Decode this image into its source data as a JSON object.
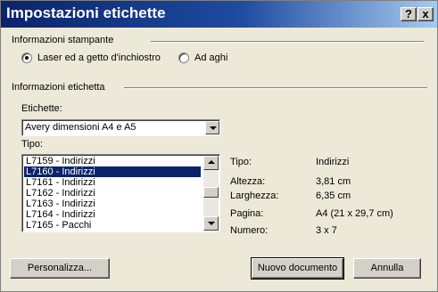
{
  "window": {
    "title": "Impostazioni etichette",
    "help_label": "?",
    "close_label": "x"
  },
  "printer": {
    "label": "Informazioni stampante",
    "options": [
      {
        "label": "Laser ed a getto d'inchiostro",
        "checked": true
      },
      {
        "label": "Ad aghi",
        "checked": false
      }
    ]
  },
  "label_info": {
    "label": "Informazioni etichetta",
    "vendor_label": "Etichette:",
    "vendor_value": "Avery dimensioni A4 e A5",
    "type_label": "Tipo:",
    "types": [
      "L7159 - Indirizzi",
      "L7160 - Indirizzi",
      "L7161 - Indirizzi",
      "L7162 - Indirizzi",
      "L7163 - Indirizzi",
      "L7164 - Indirizzi",
      "L7165 - Pacchi"
    ],
    "selected_index": 1,
    "scroll_position": 0.5
  },
  "details": [
    {
      "label": "Tipo:",
      "value": "Indirizzi"
    },
    {
      "label": "Altezza:",
      "value": "3,81 cm"
    },
    {
      "label": "Larghezza:",
      "value": "6,35 cm"
    },
    {
      "label": "Pagina:",
      "value": "A4 (21 x 29,7 cm)"
    },
    {
      "label": "Numero:",
      "value": "3 x 7"
    }
  ],
  "buttons": {
    "customize": "Personalizza...",
    "new_document": "Nuovo documento",
    "cancel": "Annulla"
  }
}
